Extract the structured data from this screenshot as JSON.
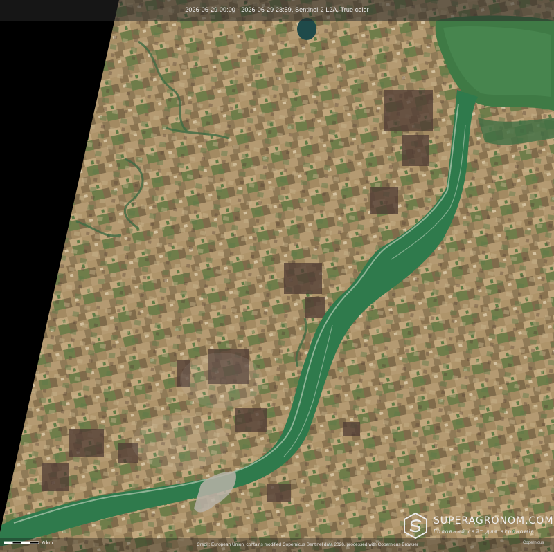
{
  "caption": "2026-06-29 00:00 - 2026-06-29 23:59, Sentinel-2 L2A, True color",
  "scale": {
    "label": "6 km"
  },
  "credit": "Credit: European Union, contains modified Copernicus Sentinel data 2026, processed with Copernicus Browser",
  "watermark": {
    "name": "SUPERAGRONOM.COM",
    "tagline": "Головний сайт для агрономів"
  },
  "copernicus_mark": "Copernicus",
  "colors": {
    "no_data": "#000000",
    "land": "#9b8460",
    "field_light": "#c7ad86",
    "field_dark": "#4e3a33",
    "vegetation": "#5c7a45",
    "river_water": "#2f7a4c",
    "river_shallow": "#b6ccb5",
    "lake": "#1f4a4a",
    "urban": "#b8b3a8"
  },
  "icons": [
    "superagronom-logo-icon",
    "scale-bar-icon"
  ]
}
